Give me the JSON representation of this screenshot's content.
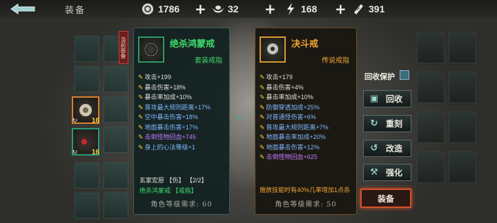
{
  "header": {
    "title": "装备",
    "resources": [
      {
        "icon": "coin-icon",
        "value": "1786"
      },
      {
        "icon": "ingot-icon",
        "value": "32"
      },
      {
        "icon": "lightning-icon",
        "value": "168"
      },
      {
        "icon": "ticket-icon",
        "value": "391"
      }
    ]
  },
  "current_badge": "当前装备",
  "slots": [
    {
      "level": "16",
      "border": "#d9822b"
    },
    {
      "level": "16",
      "border": "#2b9a7a"
    }
  ],
  "left_panel": {
    "name": "绝杀鸿蒙戒",
    "type": "套装戒指",
    "name_color": "#3fdc6e",
    "stats": [
      {
        "text": "攻击+199",
        "color": "#e0e0d8"
      },
      {
        "text": "暴击伤害+18%",
        "color": "#e0e0d8"
      },
      {
        "text": "暴击率加成+10%",
        "color": "#e0e0d8"
      },
      {
        "text": "普攻最大规则距离+17%",
        "color": "#7fb7ff"
      },
      {
        "text": "空中暴击伤害+18%",
        "color": "#7fb7ff"
      },
      {
        "text": "地面暴击伤害+17%",
        "color": "#7fb7ff"
      },
      {
        "text": "击倒怪物回血+745",
        "color": "#c07bff"
      },
      {
        "text": "身上的心法等级+1",
        "color": "#7fb7ff"
      }
    ],
    "set_name": "玄家宏愿 【伤】 【2/2】",
    "set_item": "绝杀鸿蒙戒 【戒指】",
    "req": "角色等级需求: 60"
  },
  "right_panel": {
    "name": "决斗戒",
    "type": "传说戒指",
    "name_color": "#f3a733",
    "stats": [
      {
        "text": "攻击+179",
        "color": "#e0e0d8"
      },
      {
        "text": "暴击伤害+4%",
        "color": "#e0e0d8"
      },
      {
        "text": "暴击率加成+10%",
        "color": "#e0e0d8"
      },
      {
        "text": "防御穿透加成+25%",
        "color": "#7fb7ff"
      },
      {
        "text": "对普通怪伤害+6%",
        "color": "#7fb7ff"
      },
      {
        "text": "普攻最大规则距离+7%",
        "color": "#7fb7ff"
      },
      {
        "text": "地面暴击率加成+20%",
        "color": "#7fb7ff"
      },
      {
        "text": "地面暴击伤害+12%",
        "color": "#7fb7ff"
      },
      {
        "text": "击倒怪物回血+625",
        "color": "#c07bff"
      }
    ],
    "special": "施放技能时有40%几率增加1点杀",
    "req": "角色等级需求: 50"
  },
  "actions": {
    "recycle_protect": "回收保护",
    "recycle": "回收",
    "reforge": "重刻",
    "modify": "改造",
    "enhance": "强化",
    "equip": "装备"
  }
}
